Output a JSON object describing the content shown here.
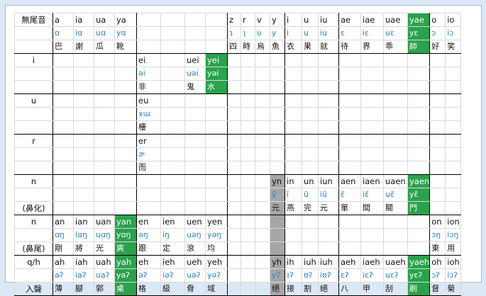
{
  "colors": {
    "highlight_green": "#2ba24c",
    "highlight_gray": "#a6a6a6",
    "ipa_blue": "#2c82c9"
  },
  "table": {
    "rows": [
      [
        "無尾音",
        "a",
        "ia",
        "ua",
        "ya",
        "",
        "",
        "",
        "",
        "z",
        "r",
        "v",
        "y",
        "i",
        "u",
        "iu",
        "ae",
        "iae",
        "uae",
        "yae",
        "o",
        "io"
      ],
      [
        "",
        "ɑ",
        "iɑ",
        "uɑ",
        "yɑ",
        "",
        "",
        "",
        "",
        "ɿ",
        "ʅ",
        "ʋ",
        "y",
        "i",
        "u",
        "iu",
        "ɛ",
        "iɛ",
        "uɛ",
        "yɛ",
        "ɔ",
        "iɔ"
      ],
      [
        "",
        "巴",
        "謝",
        "瓜",
        "靴",
        "",
        "",
        "",
        "",
        "四",
        "時",
        "烏",
        "魚",
        "衣",
        "果",
        "就",
        "待",
        "界",
        "乖",
        "帥",
        "好",
        "笑"
      ],
      [
        "i",
        "",
        "",
        "",
        "",
        "ei",
        "",
        "uei",
        "yei",
        "",
        "",
        "",
        "",
        "",
        "",
        "",
        "",
        "",
        "",
        "",
        "",
        ""
      ],
      [
        "",
        "",
        "",
        "",
        "",
        "əi",
        "",
        "uəi",
        "yəi",
        "",
        "",
        "",
        "",
        "",
        "",
        "",
        "",
        "",
        "",
        "",
        "",
        ""
      ],
      [
        "",
        "",
        "",
        "",
        "",
        "非",
        "",
        "鬼",
        "水",
        "",
        "",
        "",
        "",
        "",
        "",
        "",
        "",
        "",
        "",
        "",
        "",
        ""
      ],
      [
        "u",
        "",
        "",
        "",
        "",
        "eu",
        "",
        "",
        "",
        "",
        "",
        "",
        "",
        "",
        "",
        "",
        "",
        "",
        "",
        "",
        "",
        ""
      ],
      [
        "",
        "",
        "",
        "",
        "",
        "ɤɯ",
        "",
        "",
        "",
        "",
        "",
        "",
        "",
        "",
        "",
        "",
        "",
        "",
        "",
        "",
        "",
        ""
      ],
      [
        "",
        "",
        "",
        "",
        "",
        "樓",
        "",
        "",
        "",
        "",
        "",
        "",
        "",
        "",
        "",
        "",
        "",
        "",
        "",
        "",
        "",
        ""
      ],
      [
        "r",
        "",
        "",
        "",
        "",
        "er",
        "",
        "",
        "",
        "",
        "",
        "",
        "",
        "",
        "",
        "",
        "",
        "",
        "",
        "",
        "",
        ""
      ],
      [
        "",
        "",
        "",
        "",
        "",
        "ɚ",
        "",
        "",
        "",
        "",
        "",
        "",
        "",
        "",
        "",
        "",
        "",
        "",
        "",
        "",
        "",
        ""
      ],
      [
        "",
        "",
        "",
        "",
        "",
        "而",
        "",
        "",
        "",
        "",
        "",
        "",
        "",
        "",
        "",
        "",
        "",
        "",
        "",
        "",
        "",
        ""
      ],
      [
        "n",
        "",
        "",
        "",
        "",
        "",
        "",
        "",
        "",
        "",
        "",
        "",
        "yn",
        "in",
        "un",
        "iun",
        "aen",
        "iaen",
        "uaen",
        "yaen",
        "",
        ""
      ],
      [
        "",
        "",
        "",
        "",
        "",
        "",
        "",
        "",
        "",
        "",
        "",
        "",
        "ỹ",
        "ĩ",
        "ũ",
        "iũ",
        "ɛ̃",
        "iɛ̃",
        "uɛ̃",
        "yɛ̃",
        "",
        ""
      ],
      [
        "(鼻化)",
        "",
        "",
        "",
        "",
        "",
        "",
        "",
        "",
        "",
        "",
        "",
        "元",
        "燕",
        "完",
        "元",
        "單",
        "間",
        "關",
        "門",
        "",
        ""
      ],
      [
        "n",
        "an",
        "ian",
        "uan",
        "yan",
        "en",
        "ien",
        "uen",
        "yen",
        "",
        "",
        "",
        "",
        "",
        "",
        "",
        "",
        "",
        "",
        "",
        "on",
        "ion"
      ],
      [
        "",
        "ɑŋ",
        "iɑŋ",
        "uɑŋ",
        "yɑŋ",
        "əŋ",
        "iŋ",
        "uəŋ",
        "yəŋ",
        "",
        "",
        "",
        "",
        "",
        "",
        "",
        "",
        "",
        "",
        "",
        "ɔŋ",
        "iɔŋ"
      ],
      [
        "(鼻尾)",
        "剛",
        "將",
        "光",
        "爽",
        "跟",
        "定",
        "滾",
        "均",
        "",
        "",
        "",
        "",
        "",
        "",
        "",
        "",
        "",
        "",
        "",
        "東",
        "用"
      ],
      [
        "q/h",
        "ah",
        "iah",
        "uah",
        "yah",
        "eh",
        "ieh",
        "ueh",
        "yeh",
        "",
        "",
        "",
        "yh",
        "ih",
        "iuh",
        "iuh",
        "aeh",
        "iaeh",
        "uaeh",
        "yaeh",
        "oh",
        "ioh"
      ],
      [
        "",
        "aʔ",
        "iaʔ",
        "uaʔ",
        "yaʔ",
        "əʔ",
        "iəʔ",
        "uəʔ",
        "yəʔ",
        "",
        "",
        "",
        "yʔ",
        "ɪʔ",
        "ʊʔ",
        "iʊʔ",
        "ɛʔ",
        "iɛʔ",
        "uɛʔ",
        "yɛʔ",
        "ɔʔ",
        "iɔʔ"
      ],
      [
        "入聲",
        "薄",
        "腳",
        "郭",
        "桌",
        "格",
        "級",
        "骨",
        "域",
        "",
        "",
        "",
        "絕",
        "接",
        "割",
        "絕",
        "八",
        "甲",
        "刮",
        "刷",
        "督",
        "菊"
      ]
    ]
  }
}
